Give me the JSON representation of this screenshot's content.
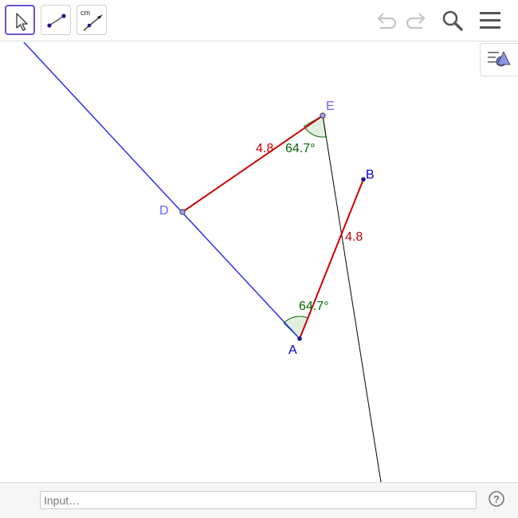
{
  "toolbar": {
    "tools": [
      {
        "name": "move-tool",
        "active": true
      },
      {
        "name": "segment-tool",
        "active": false
      },
      {
        "name": "segment-fixed-length-tool",
        "active": false,
        "label": "cm"
      }
    ]
  },
  "geometry": {
    "points": {
      "A": {
        "label": "A",
        "color": "#0000cc"
      },
      "B": {
        "label": "B",
        "color": "#0000cc"
      },
      "D": {
        "label": "D",
        "color": "#6666ff"
      },
      "E": {
        "label": "E",
        "color": "#6666ff"
      }
    },
    "segments": {
      "DE": {
        "length_label": "4.8",
        "color": "#cc0000"
      },
      "AB": {
        "length_label": "4.8",
        "color": "#cc0000"
      }
    },
    "angles": {
      "at_E": {
        "label": "64.7°",
        "color": "#006400"
      },
      "at_A": {
        "label": "64.7°",
        "color": "#006400"
      }
    },
    "colors": {
      "line": "#2e2ef0",
      "thin_line": "#000000",
      "angle_fill": "#e0f0e0"
    }
  },
  "input": {
    "placeholder": "Input…"
  }
}
